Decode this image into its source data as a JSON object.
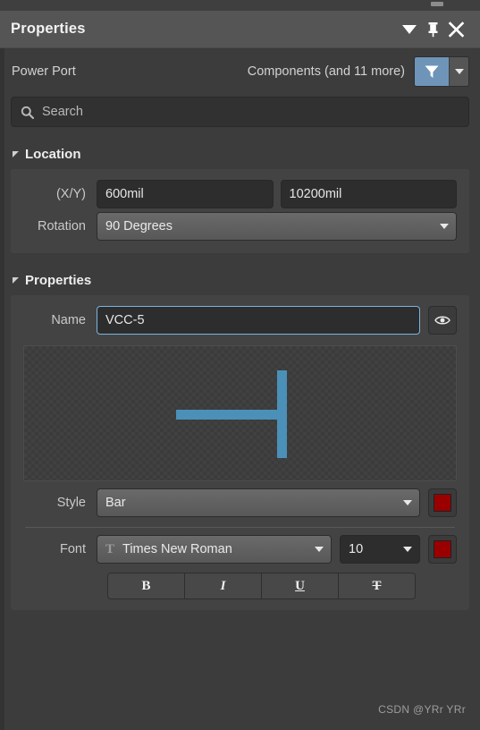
{
  "window": {
    "title": "Properties",
    "controls": [
      {
        "name": "collapse-icon",
        "glyph": "triangle-down"
      },
      {
        "name": "pin-icon",
        "glyph": "pin"
      },
      {
        "name": "close-icon",
        "glyph": "cross"
      }
    ]
  },
  "object": {
    "kind": "Power Port",
    "scope": "Components (and 11 more)",
    "filter_icon": "funnel-icon",
    "filter_dropdown_icon": "chevron-down-icon",
    "filter_accent": "#6e95b8"
  },
  "search": {
    "placeholder": "Search",
    "value": "",
    "icon": "search-icon"
  },
  "location": {
    "title": "Location",
    "xy_label": "(X/Y)",
    "x_value": "600mil",
    "y_value": "10200mil",
    "rotation_label": "Rotation",
    "rotation_value": "90 Degrees"
  },
  "properties": {
    "title": "Properties",
    "name_label": "Name",
    "name_value": "VCC-5",
    "visibility_icon": "eye-icon",
    "preview": {
      "symbol": "power-port-bar-rotated",
      "color": "#4a90b8"
    },
    "style_label": "Style",
    "style_value": "Bar",
    "style_color": "#9b0000",
    "font_label": "Font",
    "font_family": "Times New Roman",
    "font_family_icon": "text-T-icon",
    "font_size": "10",
    "font_color": "#9b0000",
    "format_buttons": [
      {
        "name": "bold-button",
        "label": "B"
      },
      {
        "name": "italic-button",
        "label": "I"
      },
      {
        "name": "underline-button",
        "label": "U"
      },
      {
        "name": "strikethrough-button",
        "label": "T"
      }
    ]
  },
  "watermark": "CSDN @YRr YRr"
}
